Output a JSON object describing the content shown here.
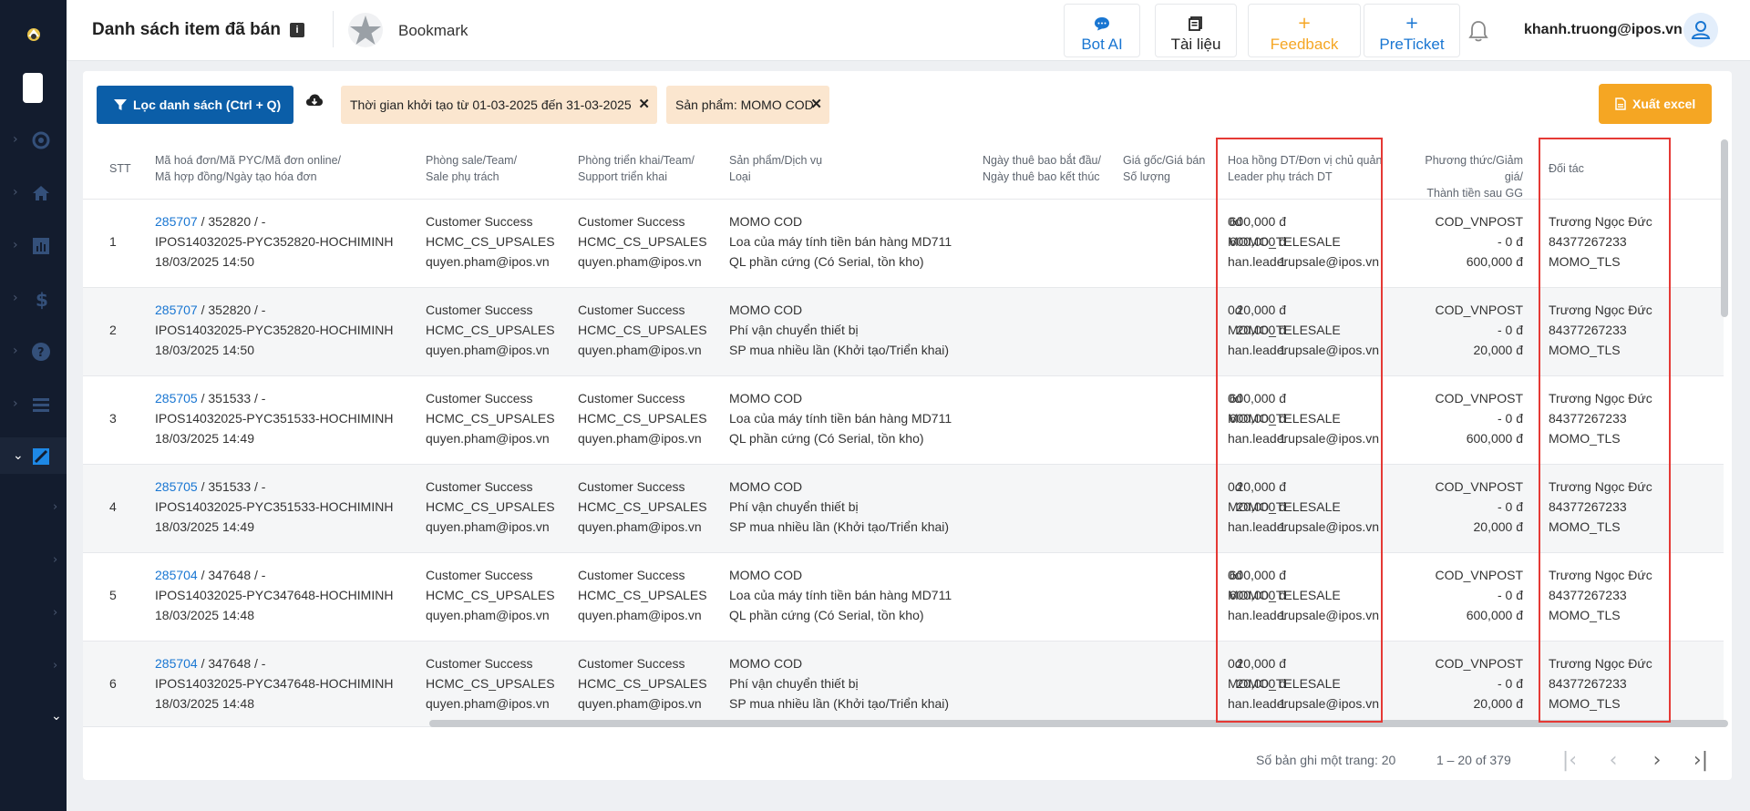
{
  "header": {
    "title": "Danh sách item đã bán",
    "bookmark": "Bookmark",
    "buttons": [
      {
        "label": "Bot AI",
        "color": "#1976d2"
      },
      {
        "label": "Tài liệu",
        "color": "#222222"
      },
      {
        "label": "Feedback",
        "color": "#f5a623"
      },
      {
        "label": "PreTicket",
        "color": "#1976d2"
      }
    ],
    "user_email": "khanh.truong@ipos.vn"
  },
  "toolbar": {
    "filter_label": "Lọc danh sách (Ctrl + Q)",
    "chips": [
      "Thời gian khởi tạo từ 01-03-2025 đến 31-03-2025",
      "Sản phẩm: MOMO COD"
    ],
    "export_label": "Xuất excel"
  },
  "table": {
    "headers": {
      "stt": "STT",
      "invoice": [
        "Mã hoá đơn/Mã PYC/Mã đơn online/",
        "Mã hợp đồng/Ngày tạo hóa đơn"
      ],
      "sale": [
        "Phòng sale/Team/",
        "Sale phụ trách"
      ],
      "deploy": [
        "Phòng triển khai/Team/",
        "Support triển khai"
      ],
      "product": [
        "Sản phẩm/Dịch vụ",
        "Loại"
      ],
      "dates": [
        "Ngày thuê bao bắt đầu/",
        "Ngày thuê bao kết thúc"
      ],
      "price": [
        "Giá gốc/Giá bán",
        "Số lượng"
      ],
      "commission": [
        "Hoa hồng DT/Đơn vị chủ quản",
        "Leader phụ trách DT"
      ],
      "payment": [
        "Phương thức/Giảm giá/",
        "Thành tiền sau GG"
      ],
      "partner": [
        "Đối tác"
      ]
    },
    "rows": [
      {
        "stt": "1",
        "invoice_no": "285707",
        "invoice_rest": " / 352820 / -",
        "pyc": "IPOS14032025-PYC352820-HOCHIMINH",
        "date": "18/03/2025 14:50",
        "sale": [
          "Customer Success",
          "HCMC_CS_UPSALES",
          "quyen.pham@ipos.vn"
        ],
        "deploy": [
          "Customer Success",
          "HCMC_CS_UPSALES",
          "quyen.pham@ipos.vn"
        ],
        "product": [
          "MOMO COD",
          "Loa của máy tính tiền bán hàng MD711",
          "QL phần cứng (Có Serial, tồn kho)"
        ],
        "price": [
          "600,000 đ",
          "600,000 đ",
          "1"
        ],
        "commission": [
          "0đ",
          "MOMO_TELESALE",
          "han.leaderupsale@ipos.vn"
        ],
        "payment": [
          "COD_VNPOST",
          "- 0 đ",
          "600,000 đ"
        ],
        "partner": [
          "Trương Ngọc Đức",
          "84377267233",
          "MOMO_TLS"
        ]
      },
      {
        "stt": "2",
        "invoice_no": "285707",
        "invoice_rest": " / 352820 / -",
        "pyc": "IPOS14032025-PYC352820-HOCHIMINH",
        "date": "18/03/2025 14:50",
        "sale": [
          "Customer Success",
          "HCMC_CS_UPSALES",
          "quyen.pham@ipos.vn"
        ],
        "deploy": [
          "Customer Success",
          "HCMC_CS_UPSALES",
          "quyen.pham@ipos.vn"
        ],
        "product": [
          "MOMO COD",
          "Phí vận chuyển thiết bị",
          "SP mua nhiều lần (Khởi tạo/Triển khai)"
        ],
        "price": [
          "20,000 đ",
          "20,000 đ",
          "1"
        ],
        "commission": [
          "0đ",
          "MOMO_TELESALE",
          "han.leaderupsale@ipos.vn"
        ],
        "payment": [
          "COD_VNPOST",
          "- 0 đ",
          "20,000 đ"
        ],
        "partner": [
          "Trương Ngọc Đức",
          "84377267233",
          "MOMO_TLS"
        ]
      },
      {
        "stt": "3",
        "invoice_no": "285705",
        "invoice_rest": " / 351533 / -",
        "pyc": "IPOS14032025-PYC351533-HOCHIMINH",
        "date": "18/03/2025 14:49",
        "sale": [
          "Customer Success",
          "HCMC_CS_UPSALES",
          "quyen.pham@ipos.vn"
        ],
        "deploy": [
          "Customer Success",
          "HCMC_CS_UPSALES",
          "quyen.pham@ipos.vn"
        ],
        "product": [
          "MOMO COD",
          "Loa của máy tính tiền bán hàng MD711",
          "QL phần cứng (Có Serial, tồn kho)"
        ],
        "price": [
          "600,000 đ",
          "600,000 đ",
          "1"
        ],
        "commission": [
          "0đ",
          "MOMO_TELESALE",
          "han.leaderupsale@ipos.vn"
        ],
        "payment": [
          "COD_VNPOST",
          "- 0 đ",
          "600,000 đ"
        ],
        "partner": [
          "Trương Ngọc Đức",
          "84377267233",
          "MOMO_TLS"
        ]
      },
      {
        "stt": "4",
        "invoice_no": "285705",
        "invoice_rest": " / 351533 / -",
        "pyc": "IPOS14032025-PYC351533-HOCHIMINH",
        "date": "18/03/2025 14:49",
        "sale": [
          "Customer Success",
          "HCMC_CS_UPSALES",
          "quyen.pham@ipos.vn"
        ],
        "deploy": [
          "Customer Success",
          "HCMC_CS_UPSALES",
          "quyen.pham@ipos.vn"
        ],
        "product": [
          "MOMO COD",
          "Phí vận chuyển thiết bị",
          "SP mua nhiều lần (Khởi tạo/Triển khai)"
        ],
        "price": [
          "20,000 đ",
          "20,000 đ",
          "1"
        ],
        "commission": [
          "0đ",
          "MOMO_TELESALE",
          "han.leaderupsale@ipos.vn"
        ],
        "payment": [
          "COD_VNPOST",
          "- 0 đ",
          "20,000 đ"
        ],
        "partner": [
          "Trương Ngọc Đức",
          "84377267233",
          "MOMO_TLS"
        ]
      },
      {
        "stt": "5",
        "invoice_no": "285704",
        "invoice_rest": " / 347648 / -",
        "pyc": "IPOS14032025-PYC347648-HOCHIMINH",
        "date": "18/03/2025 14:48",
        "sale": [
          "Customer Success",
          "HCMC_CS_UPSALES",
          "quyen.pham@ipos.vn"
        ],
        "deploy": [
          "Customer Success",
          "HCMC_CS_UPSALES",
          "quyen.pham@ipos.vn"
        ],
        "product": [
          "MOMO COD",
          "Loa của máy tính tiền bán hàng MD711",
          "QL phần cứng (Có Serial, tồn kho)"
        ],
        "price": [
          "600,000 đ",
          "600,000 đ",
          "1"
        ],
        "commission": [
          "0đ",
          "MOMO_TELESALE",
          "han.leaderupsale@ipos.vn"
        ],
        "payment": [
          "COD_VNPOST",
          "- 0 đ",
          "600,000 đ"
        ],
        "partner": [
          "Trương Ngọc Đức",
          "84377267233",
          "MOMO_TLS"
        ]
      },
      {
        "stt": "6",
        "invoice_no": "285704",
        "invoice_rest": " / 347648 / -",
        "pyc": "IPOS14032025-PYC347648-HOCHIMINH",
        "date": "18/03/2025 14:48",
        "sale": [
          "Customer Success",
          "HCMC_CS_UPSALES",
          "quyen.pham@ipos.vn"
        ],
        "deploy": [
          "Customer Success",
          "HCMC_CS_UPSALES",
          "quyen.pham@ipos.vn"
        ],
        "product": [
          "MOMO COD",
          "Phí vận chuyển thiết bị",
          "SP mua nhiều lần (Khởi tạo/Triển khai)"
        ],
        "price": [
          "20,000 đ",
          "20,000 đ",
          "1"
        ],
        "commission": [
          "0đ",
          "MOMO_TELESALE",
          "han.leaderupsale@ipos.vn"
        ],
        "payment": [
          "COD_VNPOST",
          "- 0 đ",
          "20,000 đ"
        ],
        "partner": [
          "Trương Ngọc Đức",
          "84377267233",
          "MOMO_TLS"
        ]
      }
    ]
  },
  "pagination": {
    "page_size_label": "Số bản ghi một trang: 20",
    "range": "1 – 20 of 379"
  },
  "colors": {
    "sidebar": "#131c2e",
    "primary": "#0b5ea8",
    "accent": "#f5a623",
    "chip": "#fbe6cf",
    "highlight": "#e53935"
  }
}
